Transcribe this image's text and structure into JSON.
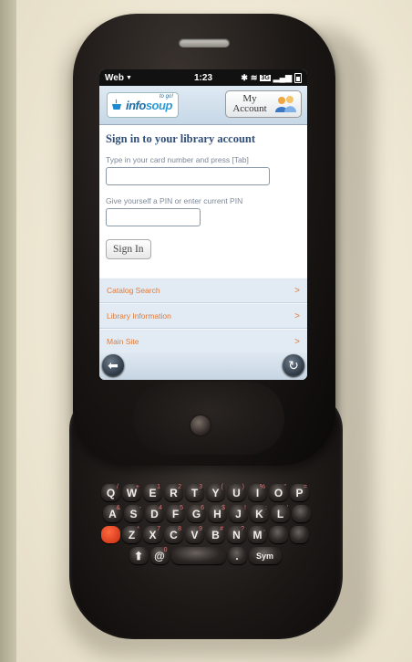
{
  "statusbar": {
    "app": "Web",
    "time": "1:23",
    "signal": "3G"
  },
  "header": {
    "logo_text_a": "info",
    "logo_text_b": "soup",
    "logo_tagline": "to go!",
    "account_line1": "My",
    "account_line2": "Account"
  },
  "content": {
    "title": "Sign in to your library account",
    "card_label": "Type in your card number and press [Tab]",
    "card_value": "",
    "pin_label": "Give yourself a PIN or enter current PIN",
    "pin_value": "",
    "signin_label": "Sign In"
  },
  "menu": [
    {
      "label": "Catalog Search",
      "chevron": ">"
    },
    {
      "label": "Library Information",
      "chevron": ">"
    },
    {
      "label": "Main Site",
      "chevron": ">"
    }
  ],
  "keyboard": {
    "row1": [
      [
        "Q",
        "/"
      ],
      [
        "W",
        "+"
      ],
      [
        "E",
        "1"
      ],
      [
        "R",
        "2"
      ],
      [
        "T",
        "3"
      ],
      [
        "Y",
        "("
      ],
      [
        "U",
        ")"
      ],
      [
        "I",
        "%"
      ],
      [
        "O",
        "\""
      ],
      [
        "P",
        "="
      ]
    ],
    "row2": [
      [
        "A",
        "&"
      ],
      [
        "S",
        "-"
      ],
      [
        "D",
        "4"
      ],
      [
        "F",
        "5"
      ],
      [
        "G",
        "6"
      ],
      [
        "H",
        "$"
      ],
      [
        "J",
        "!"
      ],
      [
        "K",
        ":"
      ],
      [
        "L",
        "'"
      ],
      [
        "",
        ""
      ]
    ],
    "row3": [
      [
        "",
        ""
      ],
      [
        "Z",
        "*"
      ],
      [
        "X",
        "7"
      ],
      [
        "C",
        "8"
      ],
      [
        "V",
        "9"
      ],
      [
        "B",
        "#"
      ],
      [
        "N",
        "?"
      ],
      [
        "M",
        ","
      ],
      [
        "",
        ""
      ],
      [
        "",
        ""
      ]
    ],
    "row4": {
      "left": "⬆",
      "at": "@",
      "zero": "0",
      "period": ".",
      "sym": "Sym"
    }
  },
  "colors": {
    "accent_orange": "#e07a3a",
    "title_blue": "#2f4e7a",
    "menu_bg": "#e2ebf4"
  }
}
